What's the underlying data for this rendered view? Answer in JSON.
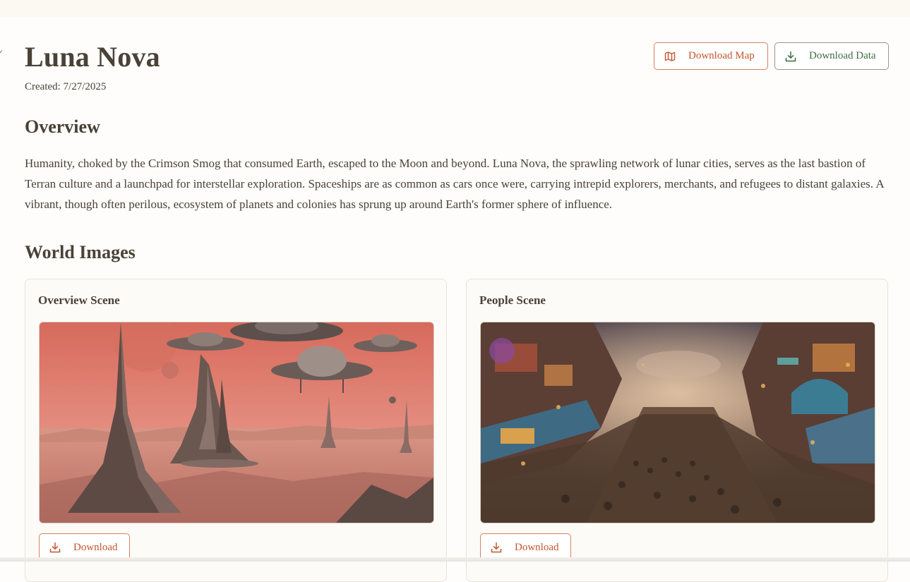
{
  "world": {
    "title": "Luna Nova",
    "created": "Created: 7/27/2025"
  },
  "actions": {
    "download_map": "Download Map",
    "download_data": "Download Data"
  },
  "overview": {
    "heading": "Overview",
    "text": "Humanity, choked by the Crimson Smog that consumed Earth, escaped to the Moon and beyond. Luna Nova, the sprawling network of lunar cities, serves as the last bastion of Terran culture and a launchpad for interstellar exploration. Spaceships are as common as cars once were, carrying intrepid explorers, merchants, and refugees to distant galaxies. A vibrant, though often perilous, ecosystem of planets and colonies has sprung up around Earth's former sphere of influence."
  },
  "images": {
    "heading": "World Images",
    "cards": [
      {
        "title": "Overview Scene",
        "download_label": "Download"
      },
      {
        "title": "People Scene",
        "download_label": "Download"
      }
    ]
  },
  "icons": {
    "map": "map-icon",
    "download": "download-icon"
  },
  "colors": {
    "accent": "#c4552d",
    "accent_border": "#d9805f",
    "secondary_text": "#3f6b42",
    "text": "#4a4137",
    "background": "#fefdfb"
  }
}
